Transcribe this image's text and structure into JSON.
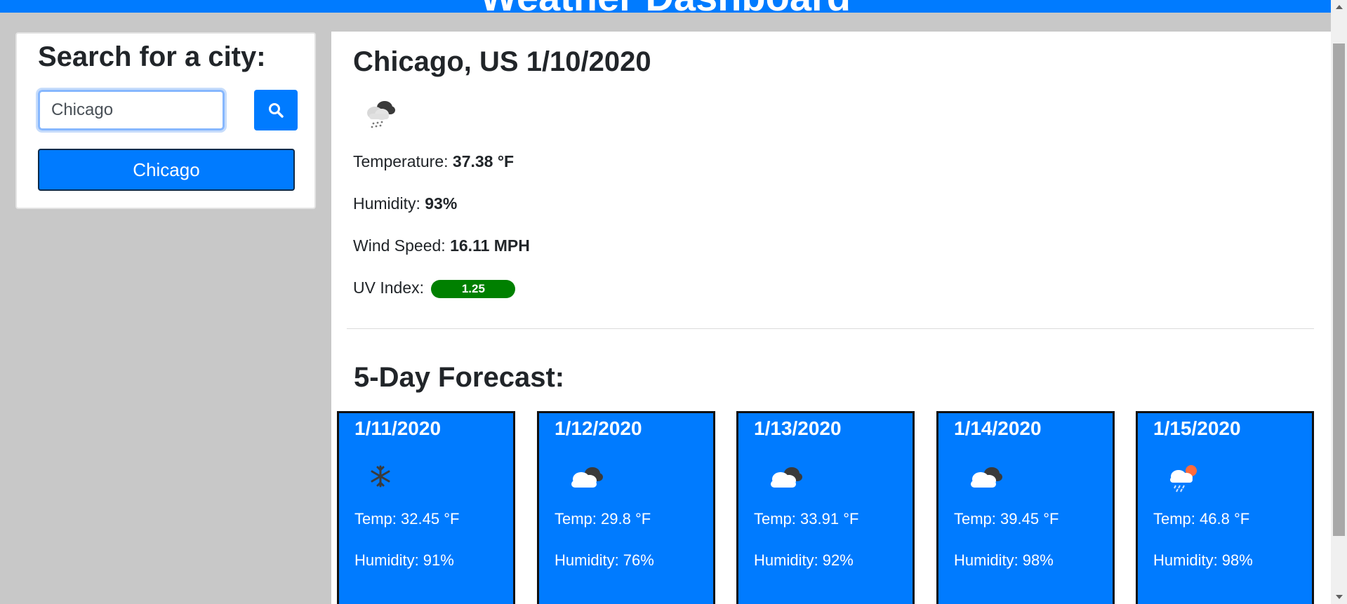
{
  "header": {
    "title": "Weather Dashboard"
  },
  "search": {
    "title": "Search for a city:",
    "input_value": "Chicago",
    "search_icon": "search-icon",
    "history": [
      "Chicago"
    ]
  },
  "current": {
    "title": "Chicago, US 1/10/2020",
    "icon": "snow-cloud-icon",
    "temperature_label": "Temperature: ",
    "temperature_value": "37.38 °F",
    "humidity_label": "Humidity: ",
    "humidity_value": "93%",
    "wind_label": "Wind Speed: ",
    "wind_value": "16.11 MPH",
    "uv_label": "UV Index: ",
    "uv_value": "1.25",
    "uv_color": "#008000"
  },
  "forecast": {
    "title": "5-Day Forecast:",
    "days": [
      {
        "date": "1/11/2020",
        "icon": "snowflake-icon",
        "temp": "Temp: 32.45 °F",
        "humidity": "Humidity: 91%"
      },
      {
        "date": "1/12/2020",
        "icon": "cloud-icon",
        "temp": "Temp: 29.8 °F",
        "humidity": "Humidity: 76%"
      },
      {
        "date": "1/13/2020",
        "icon": "cloud-icon",
        "temp": "Temp: 33.91 °F",
        "humidity": "Humidity: 92%"
      },
      {
        "date": "1/14/2020",
        "icon": "cloud-icon",
        "temp": "Temp: 39.45 °F",
        "humidity": "Humidity: 98%"
      },
      {
        "date": "1/15/2020",
        "icon": "rain-sun-cloud-icon",
        "temp": "Temp: 46.8 °F",
        "humidity": "Humidity: 98%"
      }
    ]
  },
  "colors": {
    "accent": "#007bff",
    "page_background": "#c8c8c8"
  }
}
